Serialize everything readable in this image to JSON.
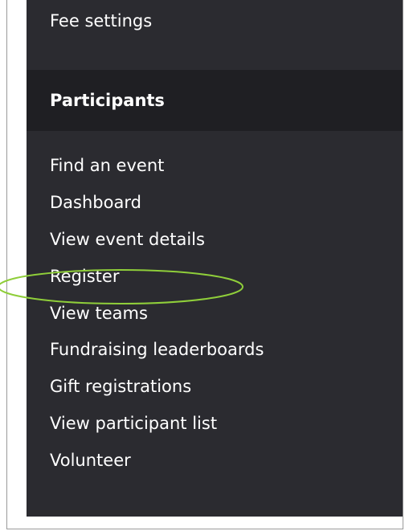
{
  "menu": {
    "previous_item": "Fee settings",
    "section_title": "Participants",
    "items": [
      {
        "label": "Find an event"
      },
      {
        "label": "Dashboard"
      },
      {
        "label": "View event details"
      },
      {
        "label": "Register"
      },
      {
        "label": "View teams"
      },
      {
        "label": "Fundraising leaderboards"
      },
      {
        "label": "Gift registrations"
      },
      {
        "label": "View participant list"
      },
      {
        "label": "Volunteer"
      }
    ]
  },
  "colors": {
    "panel_background": "#2b2b30",
    "section_header_background": "#1f1f23",
    "text": "#ffffff",
    "highlight_ellipse": "#8fce3a"
  }
}
